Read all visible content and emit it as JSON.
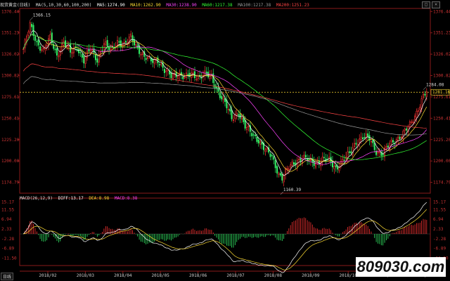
{
  "header": {
    "instrument": "现货黄金(日线)",
    "ma_params": "MA(5,10,30,60,100,200)",
    "ma_values": [
      {
        "label": "MA5:1274.90",
        "color": "#ffffff"
      },
      {
        "label": "MA10:1262.90",
        "color": "#ffdd33"
      },
      {
        "label": "MA30:1238.90",
        "color": "#ff44ff"
      },
      {
        "label": "MA60:1217.38",
        "color": "#33ff33"
      },
      {
        "label": "MA100:1217.38",
        "color": "#888888"
      },
      {
        "label": "MA200:1251.23",
        "color": "#ff4444"
      }
    ]
  },
  "macd_header": {
    "params": "MACD(26,12,9)",
    "diff": "DIFF:13.17",
    "dea": "DEA:8.98",
    "macd": "MACD:8.38"
  },
  "period_label": "日线",
  "watermark": "809030.com",
  "window_buttons": [
    "□",
    "×"
  ],
  "chart_data": [
    {
      "type": "candlestick",
      "title": "现货黄金(日线)",
      "y_ticks": [
        "1376.44",
        "1351.23",
        "1326.02",
        "1300.82",
        "1275.61",
        "1250.41",
        "1225.20",
        "1200.00",
        "1174.79"
      ],
      "ylim": [
        1162,
        1380
      ],
      "x_ticks": [
        "2018/02",
        "2018/03",
        "2018/04",
        "2018/05",
        "2018/06",
        "2018/07",
        "2018/08",
        "2018/09",
        "2018/10",
        "2018/11",
        "2018/12"
      ],
      "annotations": [
        {
          "text": "1366.15",
          "x_index": 4,
          "y": 1366.15
        },
        {
          "text": "1160.39",
          "x_index": 153,
          "y": 1160.39
        },
        {
          "text": "1284.08",
          "x_index": 238,
          "y": 1284.08
        }
      ],
      "current_price_label": "1281.16",
      "dashed_level": 1281.16,
      "anchors": [
        [
          0,
          1332
        ],
        [
          4,
          1360
        ],
        [
          8,
          1340
        ],
        [
          12,
          1330
        ],
        [
          16,
          1345
        ],
        [
          20,
          1325
        ],
        [
          24,
          1340
        ],
        [
          28,
          1328
        ],
        [
          32,
          1335
        ],
        [
          36,
          1318
        ],
        [
          40,
          1332
        ],
        [
          44,
          1320
        ],
        [
          48,
          1338
        ],
        [
          52,
          1330
        ],
        [
          56,
          1342
        ],
        [
          60,
          1336
        ],
        [
          64,
          1346
        ],
        [
          68,
          1334
        ],
        [
          72,
          1322
        ],
        [
          76,
          1318
        ],
        [
          80,
          1320
        ],
        [
          84,
          1306
        ],
        [
          88,
          1300
        ],
        [
          92,
          1304
        ],
        [
          96,
          1298
        ],
        [
          100,
          1302
        ],
        [
          104,
          1300
        ],
        [
          108,
          1302
        ],
        [
          112,
          1298
        ],
        [
          116,
          1282
        ],
        [
          120,
          1268
        ],
        [
          124,
          1250
        ],
        [
          128,
          1258
        ],
        [
          132,
          1240
        ],
        [
          136,
          1232
        ],
        [
          140,
          1225
        ],
        [
          144,
          1212
        ],
        [
          148,
          1205
        ],
        [
          152,
          1185
        ],
        [
          154,
          1180
        ],
        [
          158,
          1192
        ],
        [
          162,
          1200
        ],
        [
          166,
          1204
        ],
        [
          170,
          1200
        ],
        [
          174,
          1198
        ],
        [
          178,
          1202
        ],
        [
          182,
          1200
        ],
        [
          186,
          1192
        ],
        [
          190,
          1200
        ],
        [
          194,
          1208
        ],
        [
          198,
          1223
        ],
        [
          202,
          1228
        ],
        [
          206,
          1226
        ],
        [
          210,
          1212
        ],
        [
          214,
          1208
        ],
        [
          218,
          1220
        ],
        [
          222,
          1226
        ],
        [
          226,
          1232
        ],
        [
          230,
          1242
        ],
        [
          234,
          1258
        ],
        [
          238,
          1276
        ],
        [
          240,
          1281
        ]
      ],
      "ma_series": [
        {
          "name": "MA5",
          "color": "#ffffff",
          "period": 5
        },
        {
          "name": "MA10",
          "color": "#ffdd33",
          "period": 10
        },
        {
          "name": "MA30",
          "color": "#ff44ff",
          "period": 30
        },
        {
          "name": "MA60",
          "color": "#33ff33",
          "period": 60
        },
        {
          "name": "MA100",
          "color": "#999999",
          "period": 100
        },
        {
          "name": "MA200",
          "color": "#ff4444",
          "period": 200
        }
      ]
    },
    {
      "type": "macd",
      "y_ticks": [
        "15.17",
        "11.55",
        "6.94",
        "2.33",
        "-2.28",
        "-6.89",
        "-11.50"
      ],
      "ylim": [
        -15,
        17
      ]
    }
  ]
}
